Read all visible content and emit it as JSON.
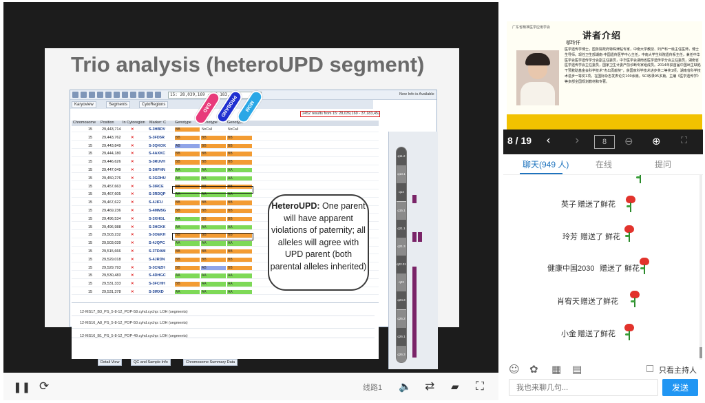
{
  "slide": {
    "title": "Trio analysis (heteroUPD segment)",
    "region": "15: 28,039,169 - 37,183,452",
    "results": "2452 results from 15: 28,039,169 - 37,183,452",
    "toolbar_tabs": [
      "Karyoview",
      "Segments",
      "CytoRegions"
    ],
    "columns": [
      "Chromosome",
      "Position",
      "In Cytoregion",
      "Marker: C",
      "Genotype",
      "Genotype",
      "Genotype"
    ],
    "parent_tags": [
      "DAD",
      "PROBAND",
      "MOM"
    ],
    "rows": [
      {
        "chr": "15",
        "pos": "29,443,714",
        "marker": "S-3HBDV",
        "g1": "BB",
        "g2": "NoCall",
        "g3": "NoCall"
      },
      {
        "chr": "15",
        "pos": "29,443,762",
        "marker": "S-3FD5R",
        "g1": "BB",
        "g2": "BB",
        "g3": "BB"
      },
      {
        "chr": "15",
        "pos": "29,443,849",
        "marker": "S-3QKOK",
        "g1": "AB",
        "g2": "BB",
        "g3": "BB"
      },
      {
        "chr": "15",
        "pos": "29,444,180",
        "marker": "S-4AXKC",
        "g1": "BB",
        "g2": "BB",
        "g3": "BB"
      },
      {
        "chr": "15",
        "pos": "29,446,626",
        "marker": "S-3RUVH",
        "g1": "BB",
        "g2": "BB",
        "g3": "BB"
      },
      {
        "chr": "15",
        "pos": "29,447,049",
        "marker": "S-3HFHN",
        "g1": "AA",
        "g2": "AA",
        "g3": "AA"
      },
      {
        "chr": "15",
        "pos": "29,450,276",
        "marker": "S-3GDHU",
        "g1": "AA",
        "g2": "AA",
        "g3": "AA"
      },
      {
        "chr": "15",
        "pos": "29,457,663",
        "marker": "S-3IRCE",
        "g1": "BB",
        "g2": "BB",
        "g3": "BB"
      },
      {
        "chr": "15",
        "pos": "29,467,605",
        "marker": "S-3RDQP",
        "g1": "AA",
        "g2": "AA",
        "g3": "AA"
      },
      {
        "chr": "15",
        "pos": "29,467,622",
        "marker": "S-4JIFU",
        "g1": "BB",
        "g2": "BB",
        "g3": "BB"
      },
      {
        "chr": "15",
        "pos": "29,469,236",
        "marker": "S-4MM5G",
        "g1": "BB",
        "g2": "BB",
        "g3": "BB"
      },
      {
        "chr": "15",
        "pos": "29,496,534",
        "marker": "S-3XHGL",
        "g1": "AA",
        "g2": "BB",
        "g3": "BB"
      },
      {
        "chr": "15",
        "pos": "29,496,988",
        "marker": "S-3HCKK",
        "g1": "AA",
        "g2": "AA",
        "g3": "AA"
      },
      {
        "chr": "15",
        "pos": "29,503,232",
        "marker": "S-3OEKH",
        "g1": "BB",
        "g2": "BB",
        "g3": "BB"
      },
      {
        "chr": "15",
        "pos": "29,503,039",
        "marker": "S-4JQPC",
        "g1": "AA",
        "g2": "AA",
        "g3": "AA"
      },
      {
        "chr": "15",
        "pos": "29,515,666",
        "marker": "S-3TDAM",
        "g1": "BB",
        "g2": "BB",
        "g3": "BB"
      },
      {
        "chr": "15",
        "pos": "29,529,018",
        "marker": "S-4JRDN",
        "g1": "BB",
        "g2": "BB",
        "g3": "BB"
      },
      {
        "chr": "15",
        "pos": "29,529,793",
        "marker": "S-3CNZH",
        "g1": "BB",
        "g2": "AB",
        "g3": "BB"
      },
      {
        "chr": "15",
        "pos": "29,530,483",
        "marker": "S-4DHGC",
        "g1": "AA",
        "g2": "AA",
        "g3": "AA"
      },
      {
        "chr": "15",
        "pos": "29,531,333",
        "marker": "S-3FCHH",
        "g1": "BB",
        "g2": "AA",
        "g3": "AA"
      },
      {
        "chr": "15",
        "pos": "29,531,378",
        "marker": "S-3IRXD",
        "g1": "AA",
        "g2": "AA",
        "g3": "AA"
      }
    ],
    "callout_bold": "HeteroUPD:",
    "callout_text": "One parent will have apparent violations of paternity; all alleles will agree with UPD parent (both parental alleles inherited)",
    "tracks": [
      "12-MS17_B3_PS_5-8-12_POP-58.cyhd.cychp: LOH (segments)",
      "12-MS16_A8_PS_5-8-12_POP-50.cyhd.cychp: LOH (segments)",
      "12-MS16_B1_PS_5-8-12_POP-49.cyhd.cychp: LOH (segments)"
    ],
    "bottom_tabs": [
      "Detail View",
      "QC and Sample Info",
      "Chromosome Summary Data"
    ],
    "info_label": "New Info is Available",
    "bands": [
      "q11.2",
      "q13.1",
      "q14",
      "q15.1",
      "q21.1",
      "q21.3",
      "q22.31",
      "q23",
      "q24.3",
      "q25.2",
      "q26.1",
      "q26.3"
    ]
  },
  "player": {
    "route_label": "线路1"
  },
  "document": {
    "header": "广东省精准医学应用学会",
    "section_title": "讲者介绍",
    "speaker_name": "邬玲仟",
    "bio": "医学遗传学博士，国务院政府特殊津贴专家，中南大学教授、妇产科一级主任医师，博士生导师。现任卫生部湖南-中国遗传医学中心主任，中南大学生科院遗传系主任，兼任中华医学会医学遗传学分会副主任委员，中华医学会湖南省医学遗传学分会主任委员，湖南省医学遗传学会主任委员，国家卫生计委产前诊断专家组成员。2014年获首届中国出生缺陷干预救助基金会科学技术\"杰出贡献奖\"，获国家科学技术进步奖二等奖1项，湖南省科学技术进步一等奖1项，在国际杂志发表论文100余篇，SCI收录95多篇。主编《医学遗传学》等多部全国规划教材和专著。"
  },
  "pager": {
    "page": "8 / 19",
    "input": "8"
  },
  "tabs": {
    "chat": "聊天(949 人)",
    "online": "在线",
    "question": "提问"
  },
  "messages": [
    {
      "user": "英子",
      "text": "赠送了鲜花"
    },
    {
      "user": "玲芳",
      "text": "赠送了 鲜花"
    },
    {
      "user": "健康中国2030",
      "text": "赠送了 鲜花"
    },
    {
      "user": "肖宥天",
      "text": "赠送了鲜花"
    },
    {
      "user": "小金",
      "text": "赠送了鲜花"
    }
  ],
  "chat": {
    "host_only": "只看主持人",
    "placeholder": "我也来聊几句...",
    "send": "发送"
  },
  "colors": {
    "send_button": "#2196f3",
    "accent": "#1e73be",
    "genotype_AA": "#7ed957",
    "genotype_BB": "#f39c33",
    "genotype_AB": "#8fa4e8"
  }
}
